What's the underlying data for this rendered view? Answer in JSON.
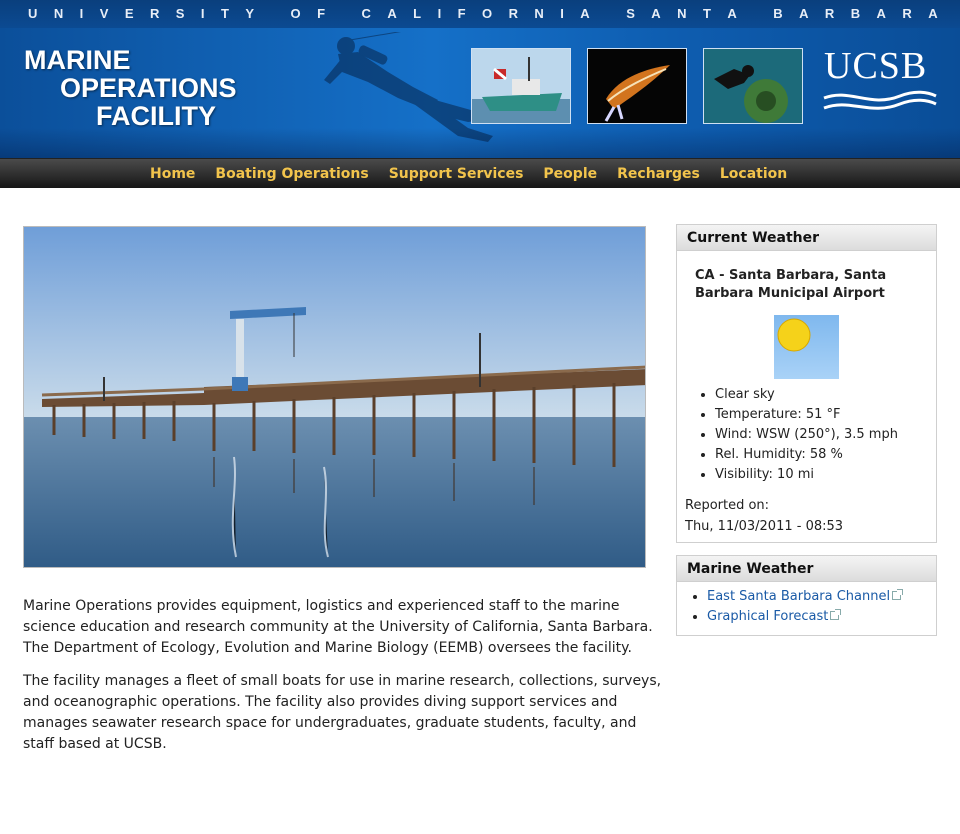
{
  "header": {
    "university": "UNIVERSITY OF CALIFORNIA SANTA BARBARA",
    "logo_line1": "MARINE",
    "logo_line2": "OPERATIONS",
    "logo_line3": "FACILITY",
    "ucsb": "UCSB"
  },
  "nav": {
    "items": [
      {
        "label": "Home"
      },
      {
        "label": "Boating Operations"
      },
      {
        "label": "Support Services"
      },
      {
        "label": "People"
      },
      {
        "label": "Recharges"
      },
      {
        "label": "Location"
      }
    ]
  },
  "main": {
    "paragraph1": "Marine Operations provides equipment, logistics and experienced staff to the marine science education and research community at the University of California, Santa Barbara. The Department of Ecology, Evolution and Marine Biology (EEMB) oversees the facility.",
    "paragraph2": "The facility manages a fleet of small boats for use in marine research, collections, surveys, and oceanographic operations. The facility also provides diving support services and manages seawater research space for undergraduates, graduate students, faculty, and staff based at UCSB."
  },
  "weather": {
    "title": "Current Weather",
    "location": "CA - Santa Barbara, Santa Barbara Municipal Airport",
    "conditions": [
      "Clear sky",
      "Temperature: 51 °F",
      "Wind: WSW (250°), 3.5 mph",
      "Rel. Humidity: 58 %",
      "Visibility: 10 mi"
    ],
    "reported_label": "Reported on:",
    "reported_time": "Thu, 11/03/2011 - 08:53"
  },
  "marine_weather": {
    "title": "Marine Weather",
    "links": [
      {
        "label": "East Santa Barbara Channel"
      },
      {
        "label": "Graphical Forecast"
      }
    ]
  },
  "colors": {
    "nav_text": "#f2c44c",
    "banner_blue": "#1570c8",
    "link": "#1a5aa6"
  }
}
